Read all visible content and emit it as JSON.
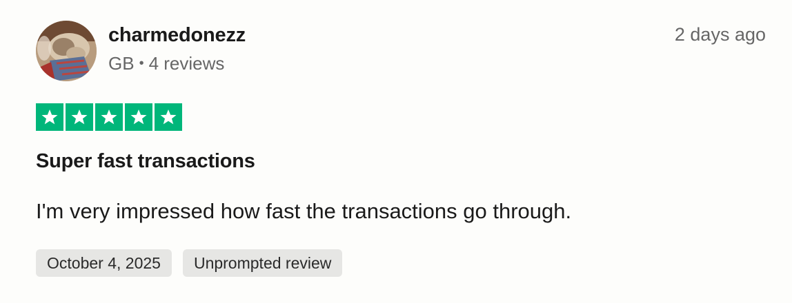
{
  "review": {
    "username": "charmedonezz",
    "country": "GB",
    "separator": "•",
    "review_count": "4 reviews",
    "posted_ago": "2 days ago",
    "rating": 5,
    "rating_max": 5,
    "title": "Super fast transactions",
    "body": "I'm very impressed how fast the transactions go through.",
    "tags": {
      "date": "October 4, 2025",
      "type": "Unprompted review"
    }
  },
  "colors": {
    "star_green": "#00b67a",
    "tag_bg": "#e6e6e4",
    "muted_text": "#666666"
  },
  "icons": {
    "avatar": "cat-photo-avatar",
    "star": "star-icon"
  }
}
